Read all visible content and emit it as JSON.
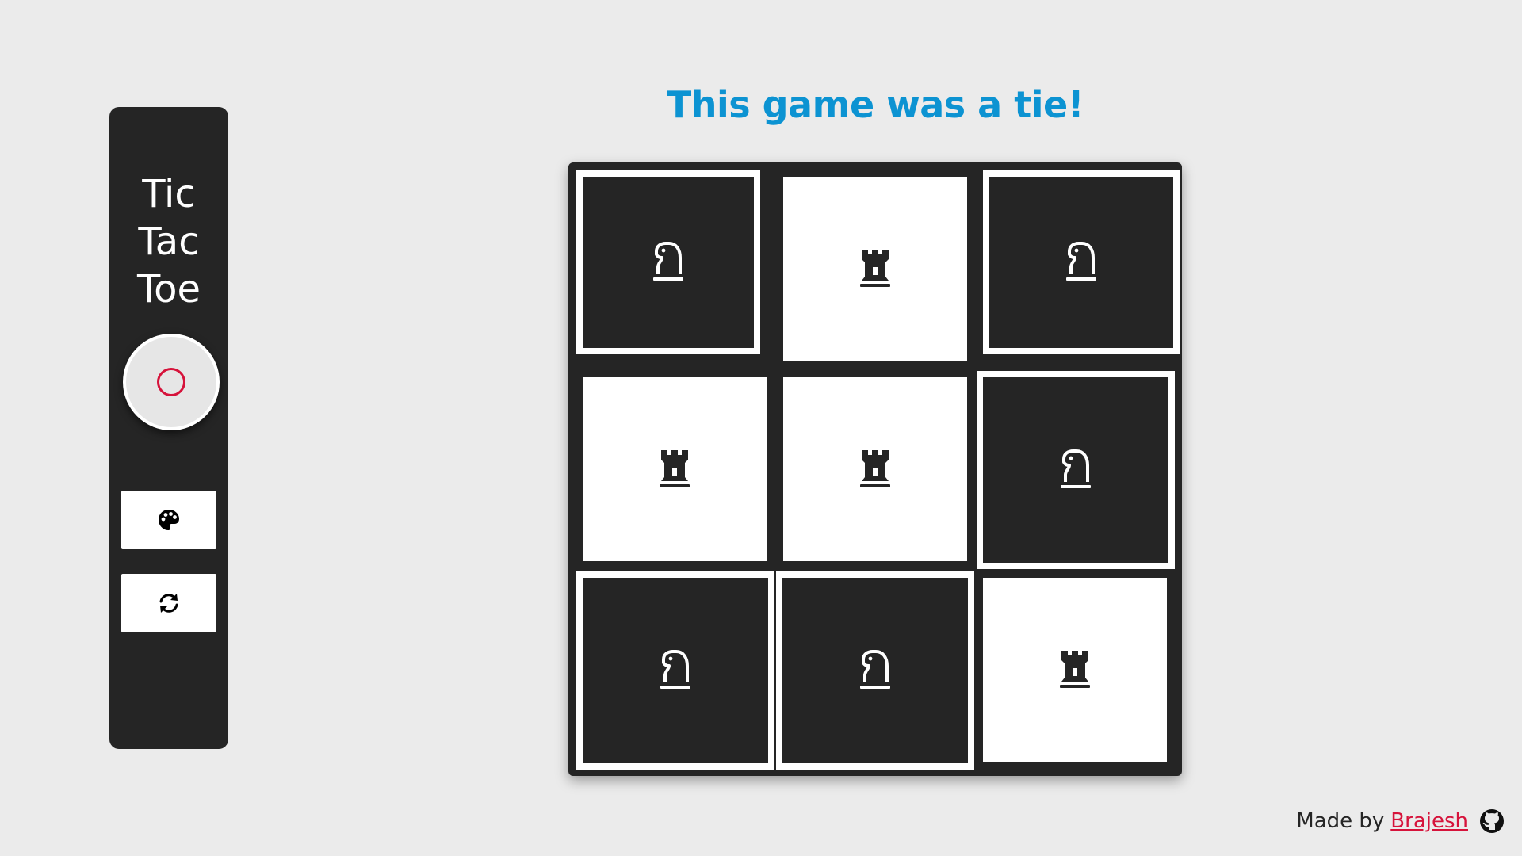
{
  "sidebar": {
    "title_lines": [
      "Tic",
      "Tac",
      "Toe"
    ],
    "current_player": "O",
    "current_player_color": "#d6133b",
    "theme_button_icon": "palette-icon",
    "reset_button_icon": "refresh-icon"
  },
  "status": {
    "message": "This game was a tie!",
    "color": "#0c93d2"
  },
  "board": {
    "cells": [
      {
        "piece": "knight",
        "piece_icon": "chess-knight-icon",
        "bg": "dark",
        "winning_outline": true
      },
      {
        "piece": "rook",
        "piece_icon": "chess-rook-icon",
        "bg": "light",
        "winning_outline": false
      },
      {
        "piece": "knight",
        "piece_icon": "chess-knight-icon",
        "bg": "dark",
        "winning_outline": true
      },
      {
        "piece": "rook",
        "piece_icon": "chess-rook-icon",
        "bg": "light",
        "winning_outline": false
      },
      {
        "piece": "rook",
        "piece_icon": "chess-rook-icon",
        "bg": "light",
        "winning_outline": false
      },
      {
        "piece": "knight",
        "piece_icon": "chess-knight-icon",
        "bg": "dark",
        "winning_outline": true
      },
      {
        "piece": "knight",
        "piece_icon": "chess-knight-icon",
        "bg": "dark",
        "winning_outline": true
      },
      {
        "piece": "knight",
        "piece_icon": "chess-knight-icon",
        "bg": "dark",
        "winning_outline": true
      },
      {
        "piece": "rook",
        "piece_icon": "chess-rook-icon",
        "bg": "light",
        "winning_outline": false
      }
    ]
  },
  "footer": {
    "made_by": "Made by",
    "author": "Brajesh",
    "author_color": "#d6133b",
    "github_icon": "github-icon"
  }
}
